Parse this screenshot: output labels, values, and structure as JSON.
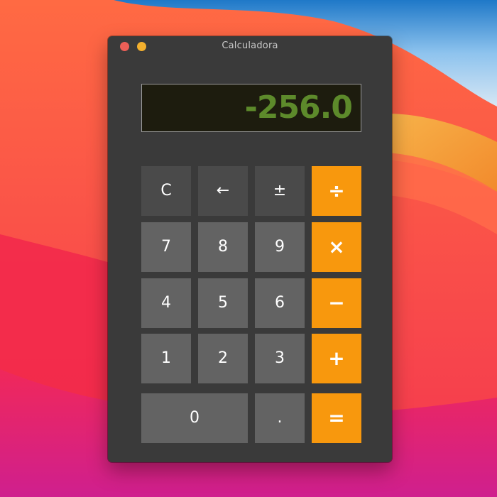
{
  "window": {
    "title": "Calculadora",
    "controls": {
      "close_color": "#ec5f57",
      "minimize_color": "#f3b02e"
    }
  },
  "display": {
    "value": "-256.0",
    "text_color": "#5d8a2b"
  },
  "keys": {
    "clear": "C",
    "backspace": "←",
    "sign": "±",
    "divide": "÷",
    "seven": "7",
    "eight": "8",
    "nine": "9",
    "multiply": "×",
    "four": "4",
    "five": "5",
    "six": "6",
    "subtract": "−",
    "one": "1",
    "two": "2",
    "three": "3",
    "add": "+",
    "zero": "0",
    "decimal": ".",
    "equals": "="
  },
  "colors": {
    "operator_key": "#f8980d",
    "function_key": "#4a4a4a",
    "digit_key": "#636363",
    "window_background": "#3a3a3a"
  }
}
